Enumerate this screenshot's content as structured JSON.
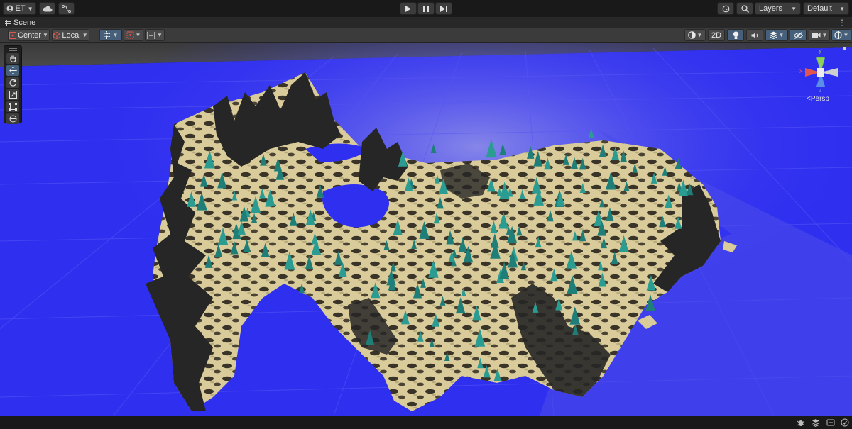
{
  "top_toolbar": {
    "account_label": "ET",
    "layers_label": "Layers",
    "layout_label": "Default"
  },
  "scene_tab": {
    "title": "Scene"
  },
  "scene_toolbar": {
    "pivot_label": "Center",
    "space_label": "Local",
    "mode_2d_label": "2D"
  },
  "orientation_gizmo": {
    "y_label": "y",
    "x_label": "x",
    "z_label": "z",
    "projection_label": "<Persp"
  },
  "colors": {
    "water": "#2f2ff0",
    "sand": "#d9cc9a",
    "rock": "#262626",
    "tree": "#2a9c92",
    "accent": "#46607c"
  }
}
